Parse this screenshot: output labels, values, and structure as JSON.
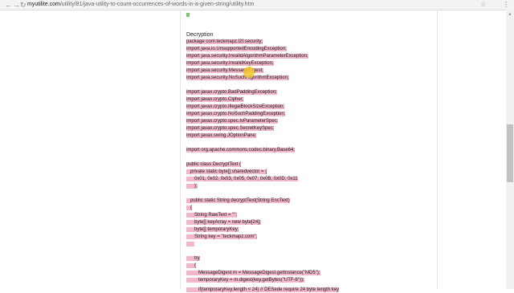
{
  "browser": {
    "url_host": "myutilite.com",
    "url_path": "/utility/81/java-utility-to-count-occurrences-of-words-in-a-given-string/utility.htm",
    "back_icon": "back-arrow-icon",
    "forward_icon": "forward-arrow-icon",
    "reload_icon": "reload-icon",
    "star_icon": "star-icon",
    "menu_icon": "menu-icon"
  },
  "page": {
    "heading": "Decryption",
    "colors": {
      "highlight": "#f2b8c9",
      "green_mark": "#7fc66f",
      "scroll_thumb": "#c1c1c1"
    }
  },
  "code": [
    "package com.teckmapz.l2f.security;",
    "import java.io.UnsupportedEncodingException;",
    "import java.security.InvalidAlgorithmParameterException;",
    "import java.security.InvalidKeyException;",
    "import java.security.MessageDigest;",
    "import java.security.NoSuchAlgorithmException;",
    "",
    "import javax.crypto.BadPaddingException;",
    "import javax.crypto.Cipher;",
    "import javax.crypto.IllegalBlockSizeException;",
    "import javax.crypto.NoSuchPaddingException;",
    "import javax.crypto.spec.IvParameterSpec;",
    "import javax.crypto.spec.SecretKeySpec;",
    "import javax.swing.JOptionPane;",
    "",
    "import org.apache.commons.codec.binary.Base64;",
    "",
    "public class DecryptText {",
    "   private static byte[] sharedvector = {",
    "      0x01, 0x02, 0x03, 0x05, 0x07, 0x0B, 0x0D, 0x11",
    "      };",
    "",
    "   public static String decryptText(String EncText)",
    "   {",
    "      String RawText = \"\";",
    "      byte[] keyArray = new byte[24];",
    "      byte[] temporaryKey;",
    "      String key = \"teckmapz.com\";",
    "      ",
    "",
    "      try",
    "      {",
    "         MessageDigest m = MessageDigest.getInstance(\"MD5\");",
    "         temporaryKey = m.digest(key.getBytes(\"UTF-8\"));",
    "",
    "         if(temporaryKey.length < 24) // DESede require 24 byte length key"
  ]
}
